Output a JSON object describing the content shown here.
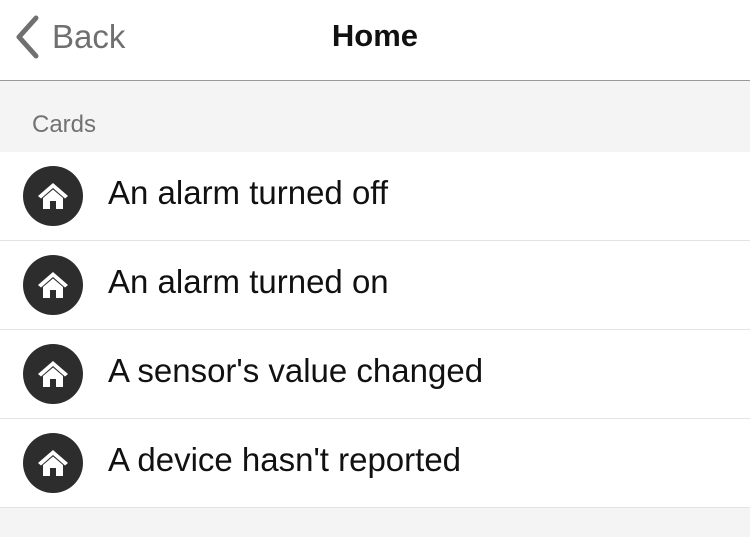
{
  "nav": {
    "back_label": "Back",
    "title": "Home"
  },
  "section": {
    "header": "Cards"
  },
  "cards": [
    {
      "label": "An alarm turned off",
      "icon": "home-icon"
    },
    {
      "label": "An alarm turned on",
      "icon": "home-icon"
    },
    {
      "label": "A sensor's value changed",
      "icon": "home-icon"
    },
    {
      "label": "A device hasn't reported",
      "icon": "home-icon"
    }
  ],
  "colors": {
    "icon_background": "#2d2d2d",
    "back_text": "#707070",
    "page_background": "#f4f4f4"
  }
}
